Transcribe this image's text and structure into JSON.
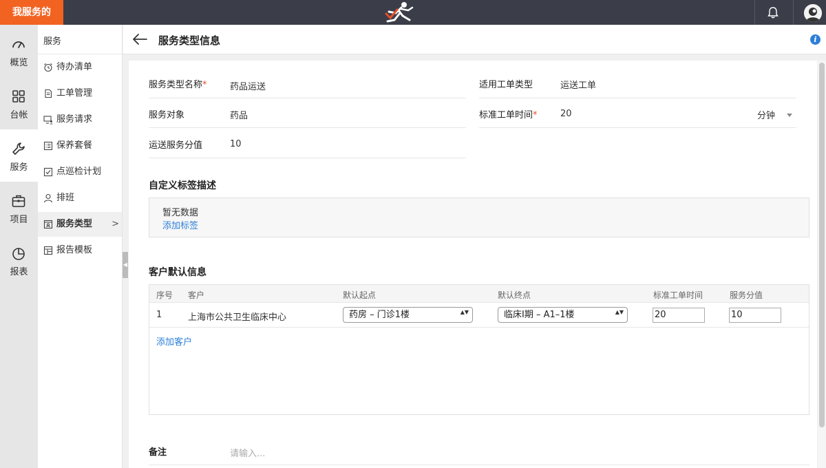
{
  "topbar": {
    "brand": "我服务的"
  },
  "rail": {
    "items": [
      {
        "label": "概览"
      },
      {
        "label": "台帐"
      },
      {
        "label": "服务"
      },
      {
        "label": "项目"
      },
      {
        "label": "报表"
      }
    ]
  },
  "submenu": {
    "title": "服务",
    "items": [
      {
        "label": "待办清单"
      },
      {
        "label": "工单管理"
      },
      {
        "label": "服务请求"
      },
      {
        "label": "保养套餐"
      },
      {
        "label": "点巡检计划"
      },
      {
        "label": "排班"
      },
      {
        "label": "服务类型",
        "chevron": ">"
      },
      {
        "label": "报告模板"
      }
    ]
  },
  "header": {
    "title": "服务类型信息",
    "info": "i"
  },
  "form": {
    "name_label": "服务类型名称",
    "name_value": "药品运送",
    "req_mark": "*",
    "target_label": "服务对象",
    "target_value": "药品",
    "score_label": "运送服务分值",
    "score_value": "10",
    "order_type_label": "适用工单类型",
    "order_type_value": "运送工单",
    "std_time_label": "标准工单时间",
    "std_time_value": "20",
    "std_time_unit": "分钟"
  },
  "tags": {
    "title": "自定义标签描述",
    "empty": "暂无数据",
    "add": "添加标签"
  },
  "customers": {
    "title": "客户默认信息",
    "columns": [
      "序号",
      "客户",
      "默认起点",
      "默认终点",
      "标准工单时间",
      "服务分值"
    ],
    "rows": [
      {
        "index": "1",
        "customer": "上海市公共卫生临床中心",
        "start": "药房 – 门诊1楼",
        "end": "临床I期 – A1–1楼",
        "std_time": "20",
        "score": "10"
      }
    ],
    "add": "添加客户",
    "updown": "▲▼"
  },
  "remark": {
    "label": "备注",
    "placeholder": "请输入..."
  },
  "colors": {
    "brand": "#f26322",
    "topbar": "#3b3e49",
    "link": "#2d7fd8",
    "required": "#e2502b"
  }
}
